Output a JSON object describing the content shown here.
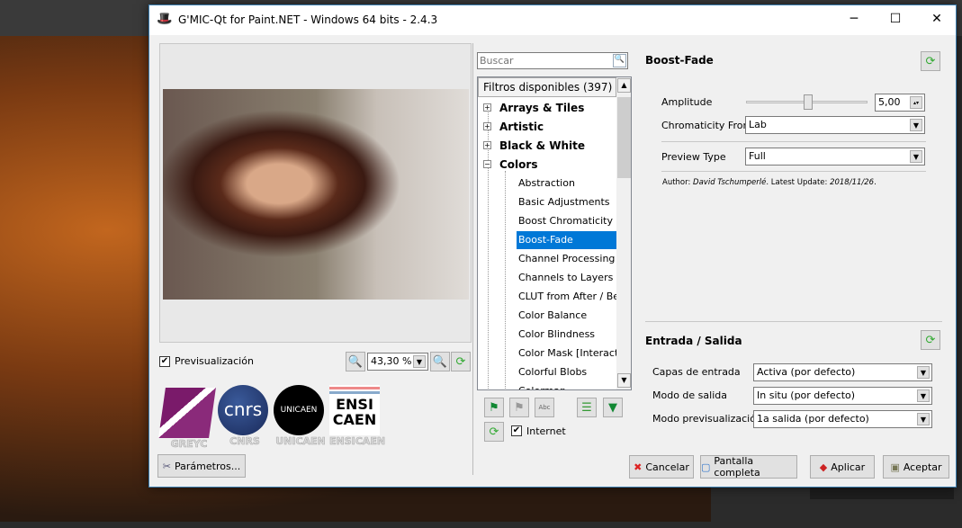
{
  "window": {
    "title": "G'MIC-Qt for Paint.NET - Windows 64 bits - 2.4.3",
    "minimize": "─",
    "maximize": "☐",
    "close": "✕"
  },
  "preview": {
    "checkbox_label": "Previsualización",
    "checked": true,
    "zoom_value": "43,30 %"
  },
  "logos": [
    "GREYC",
    "CNRS",
    "UNICAEN",
    "ENSICAEN"
  ],
  "logo_marks": {
    "cnrs": "cnrs",
    "unicaen": "UNICAEN",
    "ensicaen_top": "ENSI",
    "ensicaen_bottom": "CAEN"
  },
  "params_button": "Parámetros...",
  "search": {
    "placeholder": "Buscar",
    "value": ""
  },
  "filters": {
    "header": "Filtros disponibles (397)",
    "categories": [
      {
        "label": "Arrays & Tiles",
        "expander": "+"
      },
      {
        "label": "Artistic",
        "expander": "+"
      },
      {
        "label": "Black & White",
        "expander": "+"
      },
      {
        "label": "Colors",
        "expander": "−"
      }
    ],
    "items": [
      "Abstraction",
      "Basic Adjustments",
      "Boost Chromaticity",
      "Boost-Fade",
      "Channel Processing",
      "Channels to Layers",
      "CLUT from After / Before",
      "Color Balance",
      "Color Blindness",
      "Color Mask [Interactive]",
      "Colorful Blobs",
      "Colormap"
    ],
    "selected": "Boost-Fade",
    "internet_label": "Internet",
    "internet_checked": true
  },
  "filter": {
    "name": "Boost-Fade",
    "amplitude_label": "Amplitude",
    "amplitude_value": "5,00",
    "amplitude_fraction": 0.5,
    "chromaticity_label": "Chromaticity From",
    "chromaticity_value": "Lab",
    "preview_type_label": "Preview Type",
    "preview_type_value": "Full",
    "author_prefix": "Author: ",
    "author": "David Tschumperlé",
    "update_prefix": ". Latest Update: ",
    "update": "2018/11/26",
    "suffix": "."
  },
  "io": {
    "title": "Entrada / Salida",
    "input_label": "Capas de entrada",
    "input_value": "Activa (por defecto)",
    "output_label": "Modo de salida",
    "output_value": "In situ (por defecto)",
    "preview_label": "Modo previsualización",
    "preview_value": "1a salida (por defecto)"
  },
  "buttons": {
    "cancel": "Cancelar",
    "fullscreen": "Pantalla completa",
    "apply": "Aplicar",
    "accept": "Aceptar"
  }
}
